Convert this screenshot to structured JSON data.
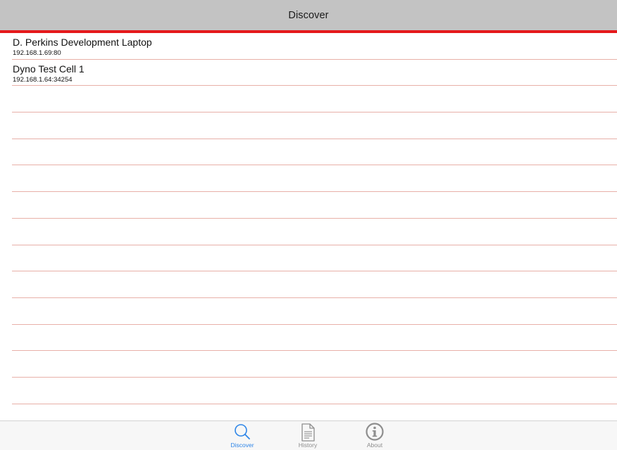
{
  "navbar": {
    "title": "Discover"
  },
  "colors": {
    "accent": "#e5191b",
    "active_tab": "#2f86e8",
    "inactive_tab": "#8e8e8e",
    "separator": "#e8b0a8"
  },
  "devices": [
    {
      "name": "D. Perkins Development Laptop",
      "address": "192.168.1.69:80"
    },
    {
      "name": "Dyno Test Cell 1",
      "address": "192.168.1.64:34254"
    }
  ],
  "empty_rows": 12,
  "tabs": [
    {
      "label": "Discover",
      "icon": "search-icon",
      "active": true
    },
    {
      "label": "History",
      "icon": "document-icon",
      "active": false
    },
    {
      "label": "About",
      "icon": "info-icon",
      "active": false
    }
  ]
}
